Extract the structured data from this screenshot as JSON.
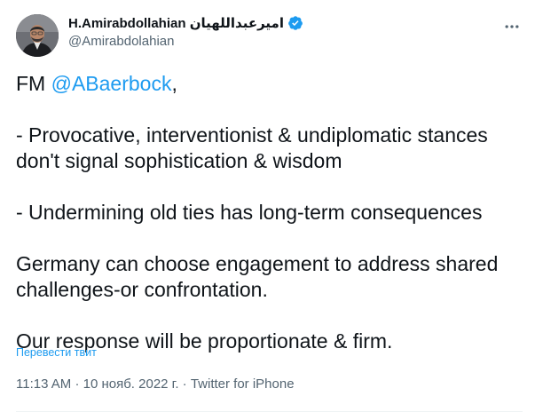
{
  "author": {
    "display_name": "H.Amirabdollahian امیرعبداللهیان",
    "handle": "@Amirabdolahian",
    "verified": true,
    "avatar_icon": "profile-photo"
  },
  "tweet": {
    "line1_prefix": "FM ",
    "mention": "@ABaerbock",
    "line1_suffix": ",",
    "para2_line1": "- Provocative, interventionist & undiplomatic stances",
    "para2_line2": "don't signal sophistication & wisdom",
    "para3": "- Undermining old ties has long-term consequences",
    "para4_line1": "Germany can choose engagement to address shared",
    "para4_line2": "challenges-or confrontation.",
    "para5": "Our response will be proportionate & firm."
  },
  "translate_label": "Перевести твит",
  "meta": {
    "time": "11:13 AM",
    "separator": "·",
    "date": "10 нояб. 2022 г.",
    "source": "Twitter for iPhone"
  },
  "colors": {
    "accent": "#1d9bf0",
    "secondary_text": "#536471",
    "primary_text": "#0f1419"
  },
  "icons": {
    "verified": "verified-badge-icon",
    "more": "more-horizontal-icon"
  }
}
